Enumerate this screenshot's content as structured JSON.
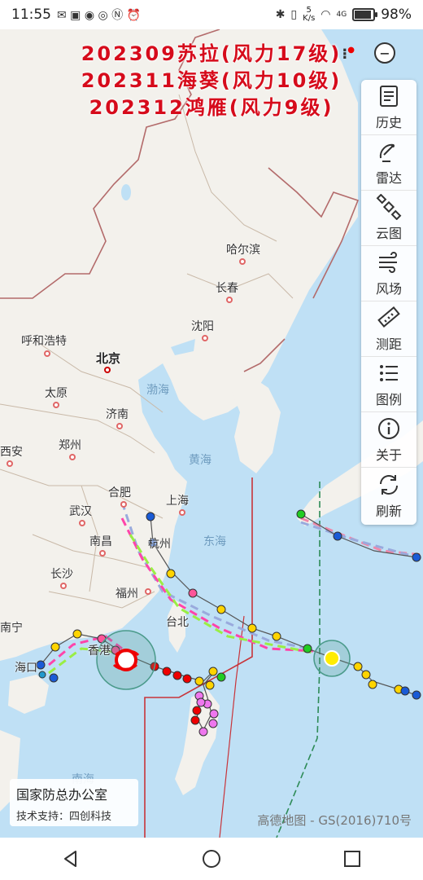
{
  "status": {
    "time": "11:55",
    "net_speed_top": "5",
    "net_speed_unit": "K/s",
    "signal": "4G",
    "battery": "98%",
    "battery_level": 0.98
  },
  "map": {
    "title_lines": [
      "202309苏拉(风力17级)",
      "202311海葵(风力10级)",
      "202312鸿雁(风力9级)"
    ],
    "toolbar": [
      {
        "label": "历史",
        "icon": "history-icon"
      },
      {
        "label": "雷达",
        "icon": "radar-icon"
      },
      {
        "label": "云图",
        "icon": "satellite-icon"
      },
      {
        "label": "风场",
        "icon": "wind-icon"
      },
      {
        "label": "测距",
        "icon": "ruler-icon"
      },
      {
        "label": "图例",
        "icon": "legend-icon"
      },
      {
        "label": "关于",
        "icon": "info-icon"
      },
      {
        "label": "刷新",
        "icon": "refresh-icon"
      }
    ],
    "cities": {
      "harbin": "哈尔滨",
      "changchun": "长春",
      "shenyang": "沈阳",
      "hohhot": "呼和浩特",
      "beijing": "北京",
      "taiyuan": "太原",
      "jinan": "济南",
      "zhengzhou": "郑州",
      "xian": "西安",
      "hefei": "合肥",
      "shanghai": "上海",
      "wuhan": "武汉",
      "hangzhou": "杭州",
      "nanchang": "南昌",
      "changsha": "长沙",
      "fuzhou": "福州",
      "taipei": "台北",
      "nanning": "南宁",
      "hongkong": "香港",
      "haikou": "海口"
    },
    "seas": {
      "bohai": "渤海",
      "yellow": "黄海",
      "east": "东海",
      "south": "南海"
    },
    "credit_line1": "国家防总办公室",
    "credit_line2": "技术支持：四创科技",
    "attribution": "高德地图 - GS(2016)710号"
  },
  "colors": {
    "title": "#d60b1b",
    "sea": "#bfe0f5",
    "land": "#f3f1ec",
    "border": "#b36b6b",
    "warning_red": "#c8343a",
    "warning_green": "#2e8b57"
  }
}
